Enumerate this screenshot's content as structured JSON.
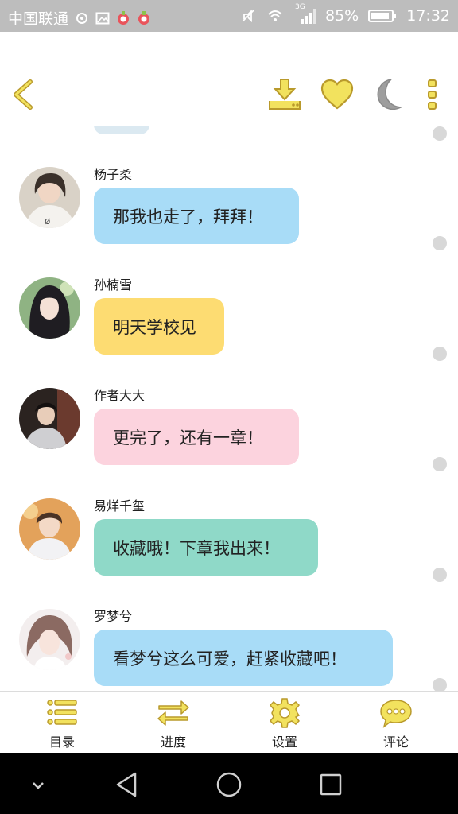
{
  "status_bar": {
    "carrier": "中国联通",
    "network_badge": "3G",
    "battery": "85%",
    "time": "17:32"
  },
  "toolbar": {
    "icons": [
      "back-chevron-icon",
      "download-icon",
      "heart-icon",
      "moon-icon",
      "more-vert-icon"
    ],
    "accent": "#f2e25e",
    "outline": "#b99a2c"
  },
  "messages": [
    {
      "sender": "杨子柔",
      "text": "那我也走了，拜拜！",
      "color": "#a8dcf7"
    },
    {
      "sender": "孙楠雪",
      "text": "明天学校见",
      "color": "#fddc72"
    },
    {
      "sender": "作者大大",
      "text": "更完了，还有一章！",
      "color": "#fcd3de"
    },
    {
      "sender": "易烊千玺",
      "text": "收藏哦！下章我出来！",
      "color": "#8fd9c8"
    },
    {
      "sender": "罗梦兮",
      "text": "看梦兮这么可爱，赶紧收藏吧！",
      "color": "#a8dcf7"
    }
  ],
  "bottom_nav": {
    "items": [
      {
        "label": "目录",
        "icon": "list-icon"
      },
      {
        "label": "进度",
        "icon": "swap-arrows-icon"
      },
      {
        "label": "设置",
        "icon": "gear-icon"
      },
      {
        "label": "评论",
        "icon": "comment-icon"
      }
    ]
  }
}
